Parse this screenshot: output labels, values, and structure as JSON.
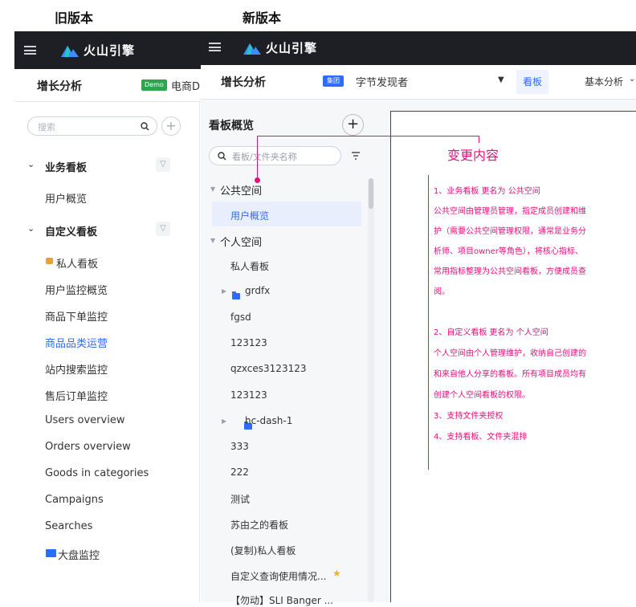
{
  "captions": {
    "old": "旧版本",
    "new": "新版本"
  },
  "old": {
    "app_name": "火山引擎",
    "header": {
      "title": "增长分析",
      "badge": "Demo",
      "project": "电商D"
    },
    "search": {
      "placeholder": "搜索"
    },
    "section_business": {
      "title": "业务看板",
      "items": [
        "用户概览"
      ]
    },
    "section_custom": {
      "title": "自定义看板",
      "private_item": "私人看板",
      "items": [
        "用户监控概览",
        "商品下单监控",
        "商品品类运营",
        "站内搜索监控",
        "售后订单监控",
        "Users overview",
        "Orders overview",
        "Goods in categories",
        "Campaigns",
        "Searches"
      ],
      "active_item": "商品品类运营",
      "folder_item": "大盘监控"
    }
  },
  "new": {
    "app_name": "火山引擎",
    "header": {
      "title": "增长分析",
      "badge": "集团",
      "project": "字节发现者",
      "tab_active": "看板",
      "tab_other": "基本分析"
    },
    "sidebar": {
      "title": "看板概览",
      "search_placeholder": "看板/文件夹名称",
      "public_space": {
        "title": "公共空间",
        "items": [
          "用户概览"
        ]
      },
      "private_space": {
        "title": "个人空间",
        "items": [
          "私人看板",
          "grdfx",
          "fgsd",
          "123123",
          "qzxces3123123",
          "123123",
          "hc-dash-1",
          "333",
          "222",
          "测试",
          "苏由之的看板",
          "(复制)私人看板",
          "自定义查询使用情况...",
          "【勿动】SLI Banger ..."
        ]
      }
    }
  },
  "annotation": {
    "title": "变更内容",
    "lines": [
      "1、业务看板 更名为 公共空间",
      "公共空间由管理员管理，指定成员创建和维",
      "护（需要公共空间管理权限，通常是业务分",
      "析师、项目owner等角色），将核心指标、",
      "常用指标整理为公共空间看板，方便成员查",
      "阅。",
      "",
      "2、自定义看板 更名为 个人空间",
      "个人空间由个人管理维护，收纳自己创建的",
      "和来自他人分享的看板。所有项目成员均有",
      "创建个人空间看板的权限。",
      "3、支持文件夹授权",
      "4、支持看板、文件夹混排"
    ],
    "color": "#e0127c"
  },
  "colors": {
    "topbar": "#1d1f24",
    "accent": "#2f6bff",
    "demo_badge": "#2da44e"
  }
}
